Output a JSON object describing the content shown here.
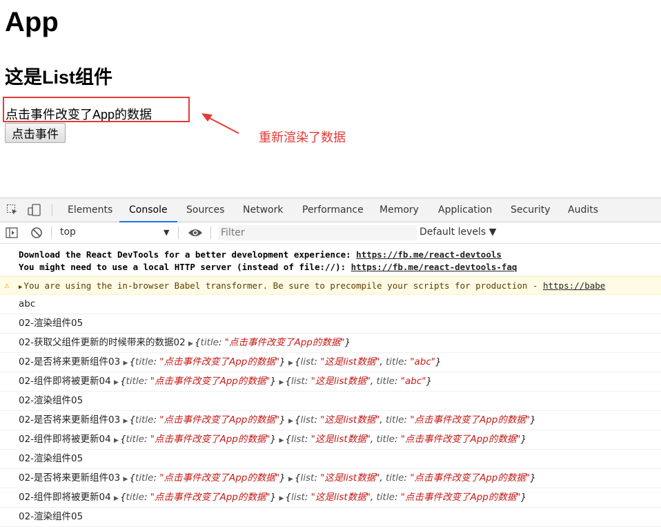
{
  "page": {
    "heading": "App",
    "list_heading": "这是List组件",
    "data_text": "点击事件改变了App的数据",
    "button_label": "点击事件",
    "annotation": "重新渲染了数据",
    "annotation_color": "#e53935"
  },
  "devtools": {
    "tabs": [
      "Elements",
      "Console",
      "Sources",
      "Network",
      "Performance",
      "Memory",
      "Application",
      "Security",
      "Audits"
    ],
    "active_tab": "Console",
    "context": "top",
    "filter_placeholder": "Filter",
    "levels": "Default levels ▼",
    "accent": "#1a73e8"
  },
  "console": {
    "info": [
      {
        "text": "Download the React DevTools for a better development experience: ",
        "link": "https://fb.me/react-devtools"
      },
      {
        "text": "You might need to use a local HTTP server (instead of file://): ",
        "link": "https://fb.me/react-devtools-faq"
      }
    ],
    "warning": {
      "text": "You are using the in-browser Babel transformer. Be sure to precompile your scripts for production - ",
      "link": "https://babe"
    },
    "rows": [
      {
        "text": "abc"
      },
      {
        "text": "02-渲染组件05"
      },
      {
        "text": "02-获取父组件更新的时候带来的数据02 ",
        "objs": [
          {
            "pairs": [
              [
                "title",
                "\"点击事件改变了App的数据\""
              ]
            ]
          }
        ]
      },
      {
        "text": "02-是否将来更新组件03 ",
        "objs": [
          {
            "pairs": [
              [
                "title",
                "\"点击事件改变了App的数据\""
              ]
            ]
          },
          {
            "pairs": [
              [
                "list",
                "\"这是list数据\""
              ],
              [
                "title",
                "\"abc\""
              ]
            ]
          }
        ]
      },
      {
        "text": "02-组件即将被更新04 ",
        "objs": [
          {
            "pairs": [
              [
                "title",
                "\"点击事件改变了App的数据\""
              ]
            ]
          },
          {
            "pairs": [
              [
                "list",
                "\"这是list数据\""
              ],
              [
                "title",
                "\"abc\""
              ]
            ]
          }
        ]
      },
      {
        "text": "02-渲染组件05"
      },
      {
        "text": "02-是否将来更新组件03 ",
        "objs": [
          {
            "pairs": [
              [
                "title",
                "\"点击事件改变了App的数据\""
              ]
            ]
          },
          {
            "pairs": [
              [
                "list",
                "\"这是list数据\""
              ],
              [
                "title",
                "\"点击事件改变了App的数据\""
              ]
            ]
          }
        ]
      },
      {
        "text": "02-组件即将被更新04 ",
        "objs": [
          {
            "pairs": [
              [
                "title",
                "\"点击事件改变了App的数据\""
              ]
            ]
          },
          {
            "pairs": [
              [
                "list",
                "\"这是list数据\""
              ],
              [
                "title",
                "\"点击事件改变了App的数据\""
              ]
            ]
          }
        ]
      },
      {
        "text": "02-渲染组件05"
      },
      {
        "text": "02-是否将来更新组件03 ",
        "objs": [
          {
            "pairs": [
              [
                "title",
                "\"点击事件改变了App的数据\""
              ]
            ]
          },
          {
            "pairs": [
              [
                "list",
                "\"这是list数据\""
              ],
              [
                "title",
                "\"点击事件改变了App的数据\""
              ]
            ]
          }
        ]
      },
      {
        "text": "02-组件即将被更新04 ",
        "objs": [
          {
            "pairs": [
              [
                "title",
                "\"点击事件改变了App的数据\""
              ]
            ]
          },
          {
            "pairs": [
              [
                "list",
                "\"这是list数据\""
              ],
              [
                "title",
                "\"点击事件改变了App的数据\""
              ]
            ]
          }
        ]
      },
      {
        "text": "02-渲染组件05"
      }
    ]
  }
}
